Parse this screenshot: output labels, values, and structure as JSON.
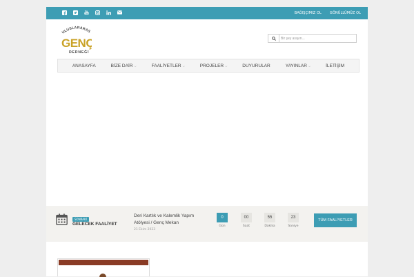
{
  "topbar": {
    "social_icons": [
      "facebook-icon",
      "twitter-icon",
      "youtube-icon",
      "instagram-icon",
      "linkedin-icon",
      "email-icon"
    ],
    "links": [
      "BAĞIŞÇIMIZ OL",
      "GÖNÜLLÜMÜZ OL"
    ]
  },
  "logo": {
    "top_text": "ULUSLARARASI",
    "main_text": "GENÇ",
    "bottom_text": "DERNEĞİ"
  },
  "search": {
    "placeholder": "Bir şey arayın..."
  },
  "nav": {
    "items": [
      {
        "label": "ANASAYFA",
        "dropdown": false
      },
      {
        "label": "BİZE DAİR",
        "dropdown": true
      },
      {
        "label": "FAALİYETLER",
        "dropdown": true
      },
      {
        "label": "PROJELER",
        "dropdown": true
      },
      {
        "label": "DUYURULAR",
        "dropdown": false
      },
      {
        "label": "YAYINLAR",
        "dropdown": true
      },
      {
        "label": "İLETİŞİM",
        "dropdown": false
      }
    ]
  },
  "event": {
    "badge": "SONRAKİ",
    "type": "GELECEK FAALİYET",
    "title": "Deri Kartlık ve Kalemlik Yapım Atölyesi / Genç Mekan",
    "date": "21 Ekim 2023",
    "countdown": [
      {
        "value": "0",
        "label": "Gün"
      },
      {
        "value": "00",
        "label": "Saat"
      },
      {
        "value": "55",
        "label": "Dakika"
      },
      {
        "value": "23",
        "label": "Saniye"
      }
    ],
    "all_button": "TÜM FAALİYETLER"
  },
  "colors": {
    "accent": "#3d9db4",
    "logo_gold": "#c9a227",
    "card_strip": "#8a3b25"
  }
}
